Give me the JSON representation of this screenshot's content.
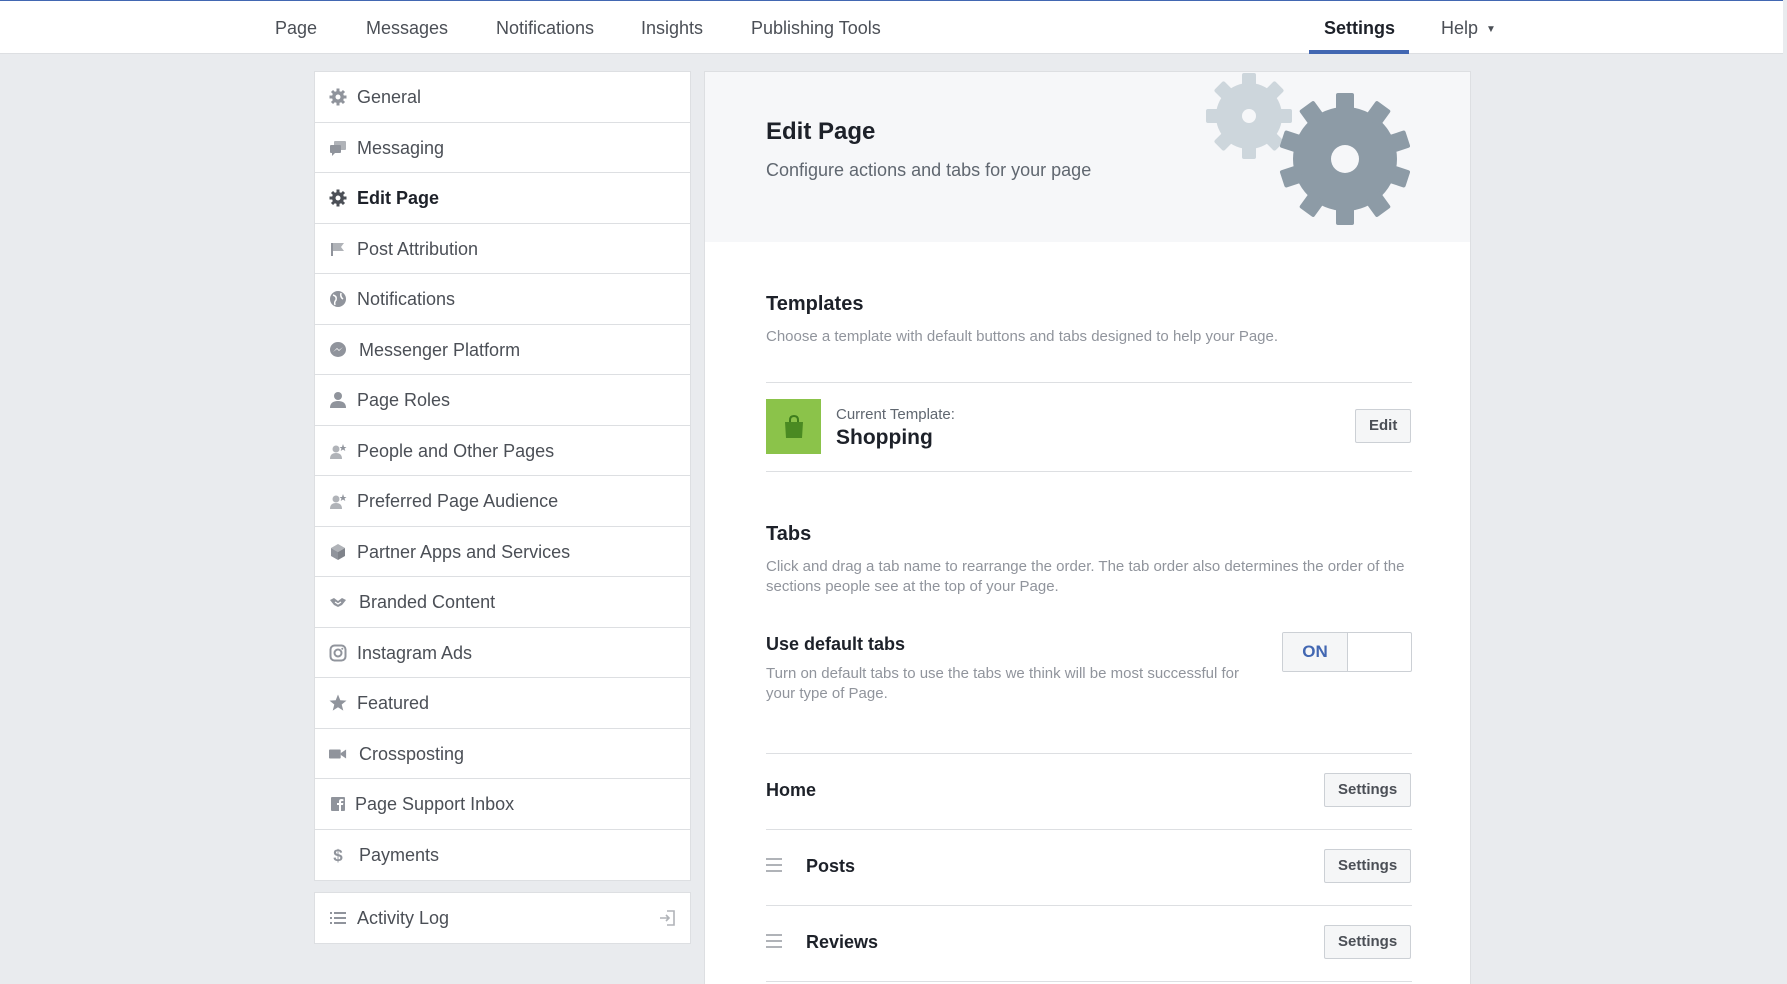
{
  "topnav": {
    "items": [
      "Page",
      "Messages",
      "Notifications",
      "Insights",
      "Publishing Tools"
    ],
    "settings": "Settings",
    "help": "Help"
  },
  "sidebar": {
    "items": [
      {
        "label": "General",
        "icon": "gear-icon"
      },
      {
        "label": "Messaging",
        "icon": "chat-icon"
      },
      {
        "label": "Edit Page",
        "icon": "gear-icon"
      },
      {
        "label": "Post Attribution",
        "icon": "flag-icon"
      },
      {
        "label": "Notifications",
        "icon": "globe-icon"
      },
      {
        "label": "Messenger Platform",
        "icon": "messenger-icon"
      },
      {
        "label": "Page Roles",
        "icon": "person-icon"
      },
      {
        "label": "People and Other Pages",
        "icon": "person-star-icon"
      },
      {
        "label": "Preferred Page Audience",
        "icon": "person-star-icon"
      },
      {
        "label": "Partner Apps and Services",
        "icon": "cube-icon"
      },
      {
        "label": "Branded Content",
        "icon": "handshake-icon"
      },
      {
        "label": "Instagram Ads",
        "icon": "instagram-icon"
      },
      {
        "label": "Featured",
        "icon": "star-icon"
      },
      {
        "label": "Crossposting",
        "icon": "video-camera-icon"
      },
      {
        "label": "Page Support Inbox",
        "icon": "facebook-icon"
      },
      {
        "label": "Payments",
        "icon": "dollar-icon"
      }
    ],
    "active_index": 2,
    "activity_log": "Activity Log"
  },
  "main": {
    "title": "Edit Page",
    "subtitle": "Configure actions and tabs for your page",
    "templates": {
      "title": "Templates",
      "description": "Choose a template with default buttons and tabs designed to help your Page.",
      "current_label": "Current Template:",
      "current_name": "Shopping",
      "edit_button": "Edit",
      "template_color": "#8bc34a"
    },
    "tabs": {
      "title": "Tabs",
      "description": "Click and drag a tab name to rearrange the order. The tab order also determines the order of the sections people see at the top of your Page.",
      "default_title": "Use default tabs",
      "default_description": "Turn on default tabs to use the tabs we think will be most successful for your type of Page.",
      "toggle_label": "ON",
      "rows": [
        {
          "name": "Home",
          "button": "Settings"
        },
        {
          "name": "Posts",
          "button": "Settings"
        },
        {
          "name": "Reviews",
          "button": "Settings"
        }
      ]
    }
  },
  "colors": {
    "accent": "#4267b2",
    "background": "#e9ebee",
    "gear_dark": "#8d9ba6",
    "gear_light": "#cdd6dc"
  }
}
